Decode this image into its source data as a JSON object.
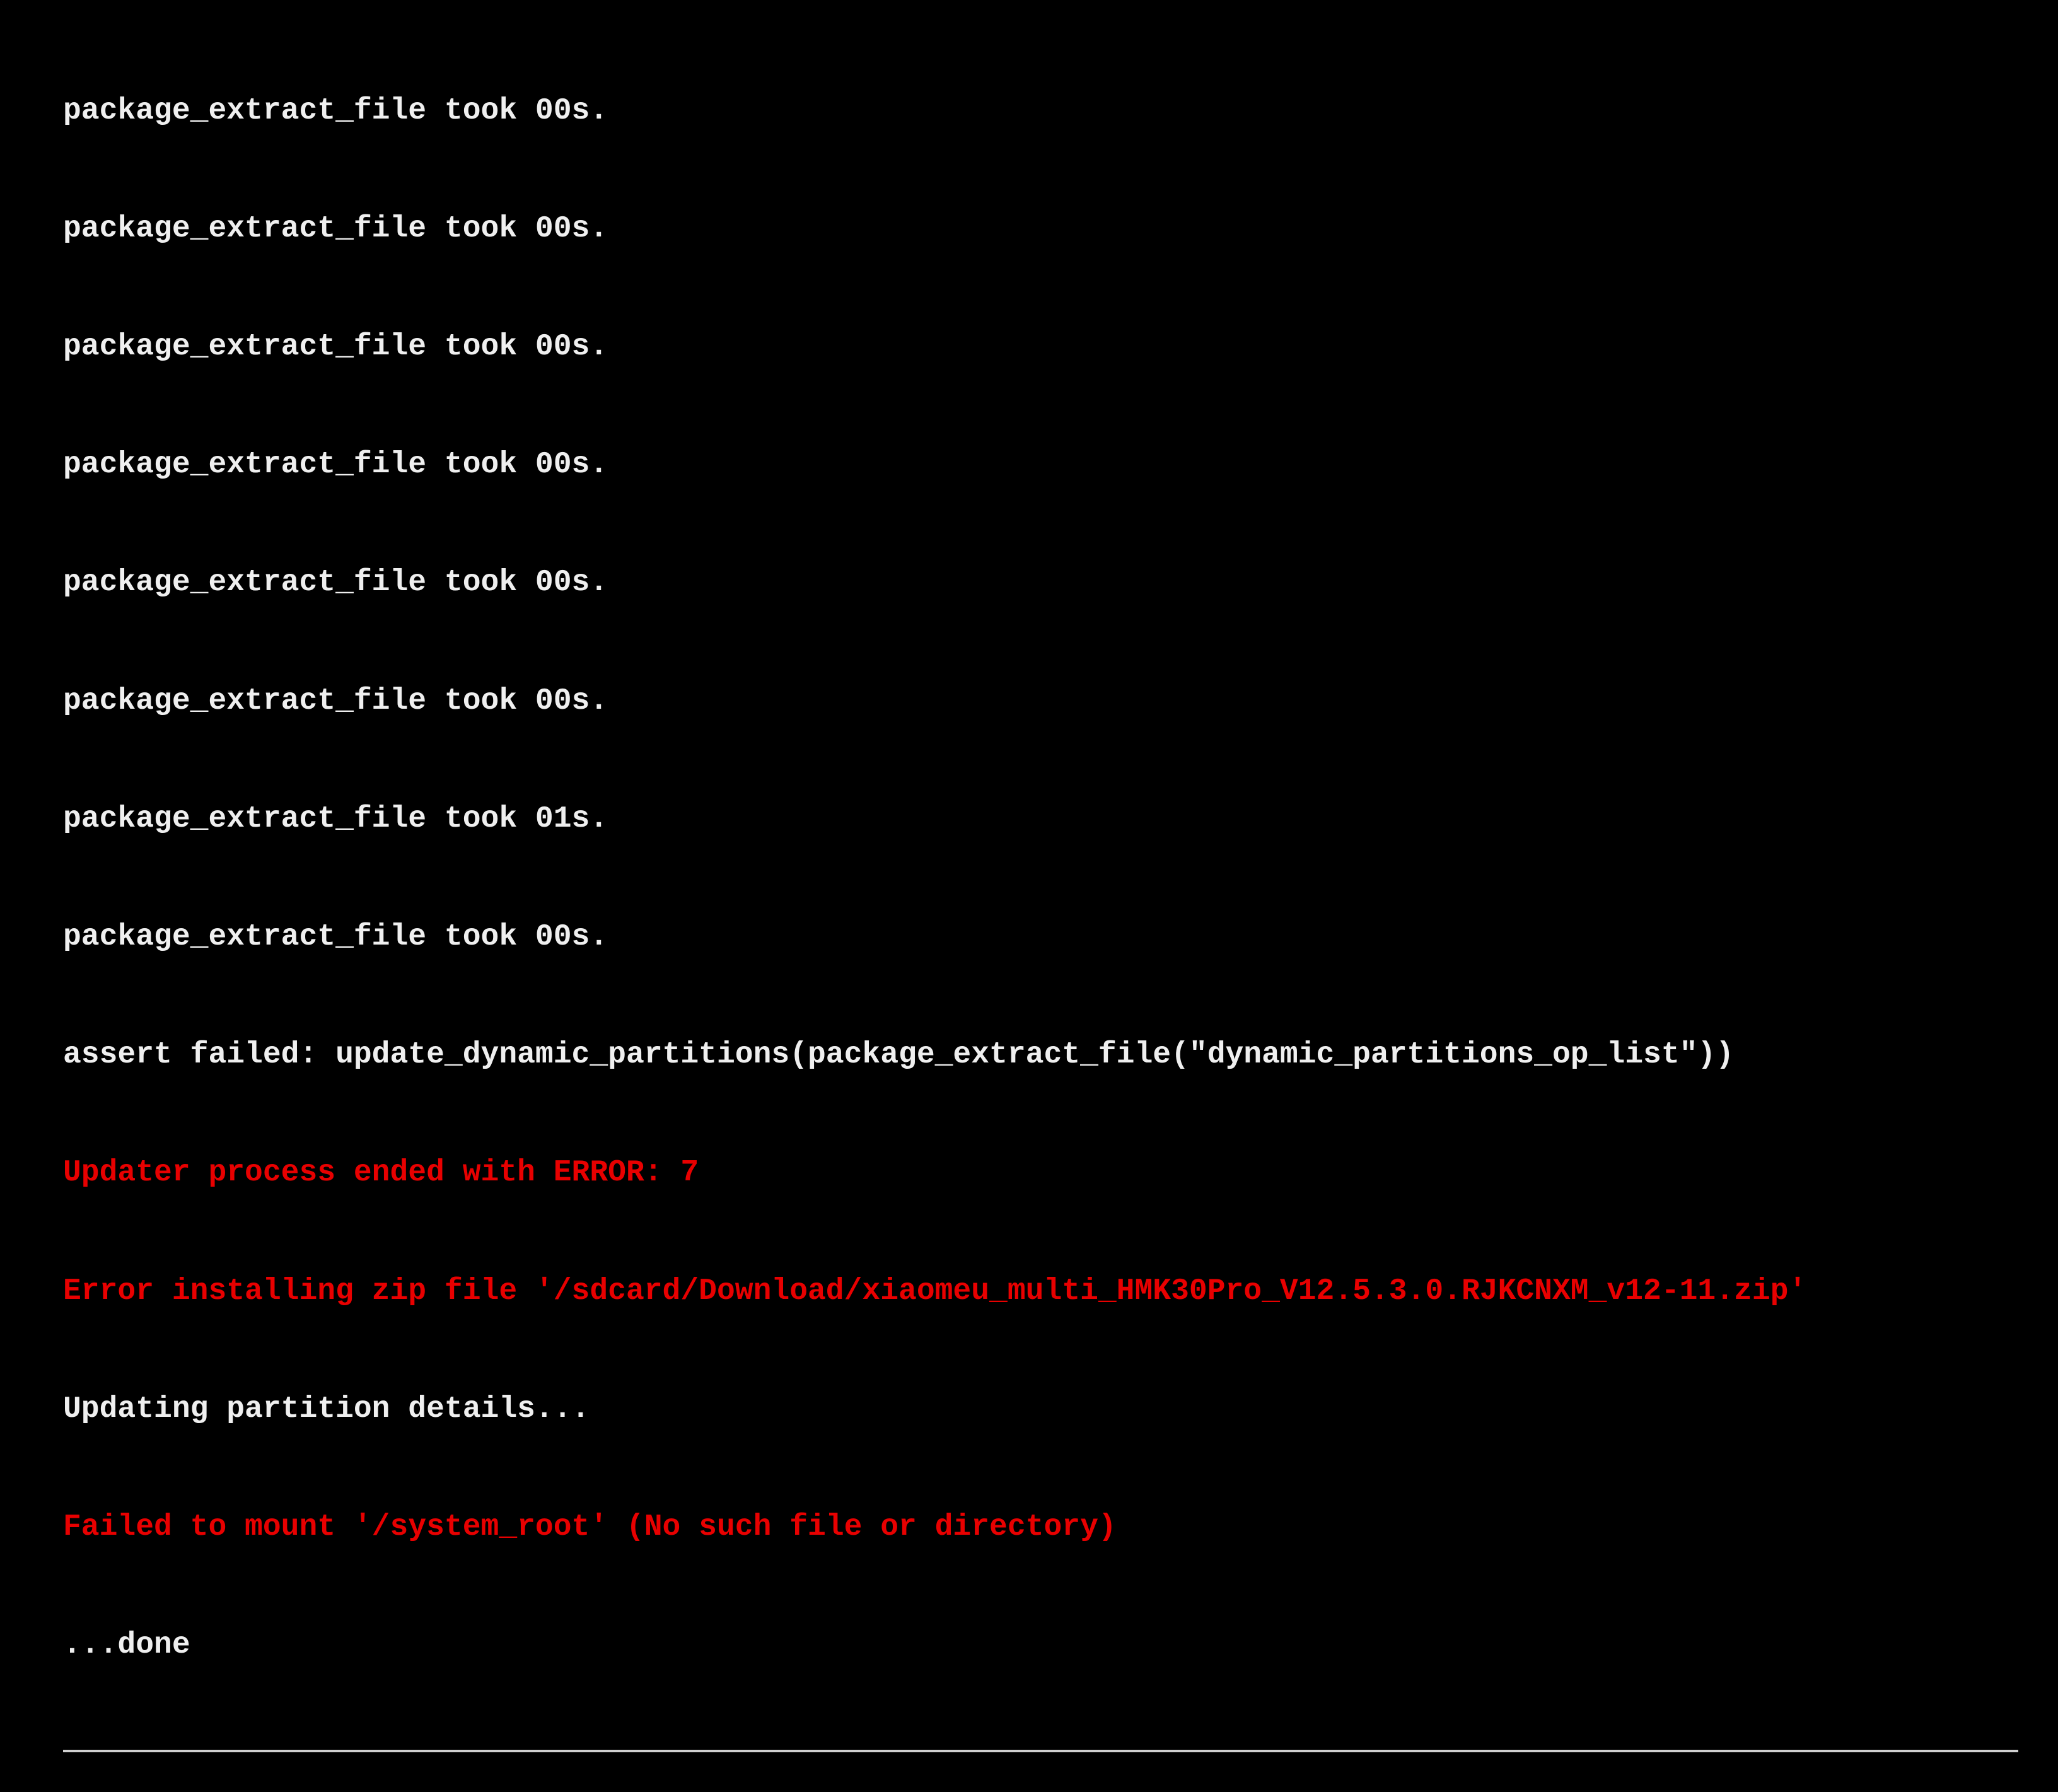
{
  "terminal": {
    "lines": [
      {
        "text": "package_extract_file took 00s.",
        "color": "white"
      },
      {
        "text": "package_extract_file took 00s.",
        "color": "white"
      },
      {
        "text": "package_extract_file took 00s.",
        "color": "white"
      },
      {
        "text": "package_extract_file took 00s.",
        "color": "white"
      },
      {
        "text": "package_extract_file took 00s.",
        "color": "white"
      },
      {
        "text": "package_extract_file took 00s.",
        "color": "white"
      },
      {
        "text": "package_extract_file took 01s.",
        "color": "white"
      },
      {
        "text": "package_extract_file took 00s.",
        "color": "white"
      },
      {
        "text": "assert failed: update_dynamic_partitions(package_extract_file(\"dynamic_partitions_op_list\"))",
        "color": "white"
      },
      {
        "text": "Updater process ended with ERROR: 7",
        "color": "red"
      },
      {
        "text": "Error installing zip file '/sdcard/Download/xiaomeu_multi_HMK30Pro_V12.5.3.0.RJKCNXM_v12-11.zip'",
        "color": "red"
      },
      {
        "text": "Updating partition details...",
        "color": "white"
      },
      {
        "text": "Failed to mount '/system_root' (No such file or directory)",
        "color": "red"
      },
      {
        "text": "...done",
        "color": "white"
      }
    ]
  },
  "colors": {
    "background": "#000000",
    "text_normal": "#efefef",
    "text_error": "#e80000",
    "divider": "#d0d0d0"
  }
}
